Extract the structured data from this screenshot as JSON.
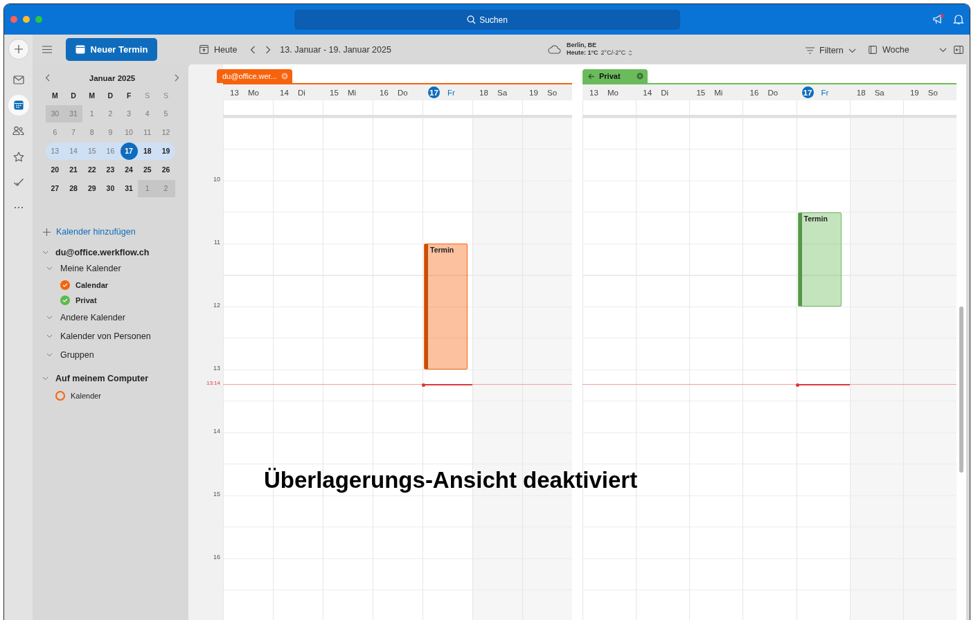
{
  "titlebar": {
    "search_placeholder": "Suchen"
  },
  "rail": [
    {
      "selected": false
    },
    {
      "selected": true
    },
    {
      "selected": false
    },
    {
      "selected": false
    },
    {
      "selected": false
    },
    {
      "selected": false
    }
  ],
  "toolbar": {
    "new_event": "Neuer Termin",
    "today": "Heute",
    "date_range": "13. Januar - 19. Januar 2025",
    "weather": {
      "city": "Berlin, BE",
      "today": "Heute: 1°C",
      "range": "2°C/-2°C"
    },
    "filter": "Filtern",
    "view": "Woche"
  },
  "mini_calendar": {
    "title": "Januar 2025",
    "weekdays": [
      {
        "label": "M",
        "weekend": false
      },
      {
        "label": "D",
        "weekend": false
      },
      {
        "label": "M",
        "weekend": false
      },
      {
        "label": "D",
        "weekend": false
      },
      {
        "label": "F",
        "weekend": false
      },
      {
        "label": "S",
        "weekend": true
      },
      {
        "label": "S",
        "weekend": true
      }
    ],
    "weeks": [
      {
        "highlighted": false,
        "days": [
          {
            "d": "30",
            "other_month": true,
            "past": true,
            "selected": false
          },
          {
            "d": "31",
            "other_month": true,
            "past": true,
            "selected": false
          },
          {
            "d": "1",
            "other_month": false,
            "past": true,
            "selected": false
          },
          {
            "d": "2",
            "other_month": false,
            "past": true,
            "selected": false
          },
          {
            "d": "3",
            "other_month": false,
            "past": true,
            "selected": false
          },
          {
            "d": "4",
            "other_month": false,
            "past": true,
            "selected": false
          },
          {
            "d": "5",
            "other_month": false,
            "past": true,
            "selected": false
          }
        ]
      },
      {
        "highlighted": false,
        "days": [
          {
            "d": "6",
            "other_month": false,
            "past": true,
            "selected": false
          },
          {
            "d": "7",
            "other_month": false,
            "past": true,
            "selected": false
          },
          {
            "d": "8",
            "other_month": false,
            "past": true,
            "selected": false
          },
          {
            "d": "9",
            "other_month": false,
            "past": true,
            "selected": false
          },
          {
            "d": "10",
            "other_month": false,
            "past": true,
            "selected": false
          },
          {
            "d": "11",
            "other_month": false,
            "past": true,
            "selected": false
          },
          {
            "d": "12",
            "other_month": false,
            "past": true,
            "selected": false
          }
        ]
      },
      {
        "highlighted": true,
        "days": [
          {
            "d": "13",
            "other_month": false,
            "past": true,
            "selected": false
          },
          {
            "d": "14",
            "other_month": false,
            "past": true,
            "selected": false
          },
          {
            "d": "15",
            "other_month": false,
            "past": true,
            "selected": false
          },
          {
            "d": "16",
            "other_month": false,
            "past": true,
            "selected": false
          },
          {
            "d": "17",
            "other_month": false,
            "past": false,
            "selected": true
          },
          {
            "d": "18",
            "other_month": false,
            "past": false,
            "selected": false
          },
          {
            "d": "19",
            "other_month": false,
            "past": false,
            "selected": false
          }
        ]
      },
      {
        "highlighted": false,
        "days": [
          {
            "d": "20",
            "other_month": false,
            "past": false,
            "selected": false
          },
          {
            "d": "21",
            "other_month": false,
            "past": false,
            "selected": false
          },
          {
            "d": "22",
            "other_month": false,
            "past": false,
            "selected": false
          },
          {
            "d": "23",
            "other_month": false,
            "past": false,
            "selected": false
          },
          {
            "d": "24",
            "other_month": false,
            "past": false,
            "selected": false
          },
          {
            "d": "25",
            "other_month": false,
            "past": false,
            "selected": false
          },
          {
            "d": "26",
            "other_month": false,
            "past": false,
            "selected": false
          }
        ]
      },
      {
        "highlighted": false,
        "days": [
          {
            "d": "27",
            "other_month": false,
            "past": false,
            "selected": false
          },
          {
            "d": "28",
            "other_month": false,
            "past": false,
            "selected": false
          },
          {
            "d": "29",
            "other_month": false,
            "past": false,
            "selected": false
          },
          {
            "d": "30",
            "other_month": false,
            "past": false,
            "selected": false
          },
          {
            "d": "31",
            "other_month": false,
            "past": false,
            "selected": false
          },
          {
            "d": "1",
            "other_month": true,
            "past": true,
            "selected": false
          },
          {
            "d": "2",
            "other_month": true,
            "past": true,
            "selected": false
          }
        ]
      }
    ]
  },
  "sidebar": {
    "add_calendar": "Kalender hinzufügen",
    "accounts": [
      {
        "label": "du@office.werkflow.ch",
        "expanded": true,
        "children": [
          {
            "kind": "group",
            "label": "Meine Kalender",
            "expanded": true,
            "children": [
              {
                "kind": "calendar",
                "label": "Calendar",
                "checked": true,
                "color": "#f7630c"
              },
              {
                "kind": "calendar",
                "label": "Privat",
                "checked": true,
                "color": "#5fb94e"
              }
            ]
          },
          {
            "kind": "group",
            "label": "Andere Kalender",
            "expanded": true
          },
          {
            "kind": "group",
            "label": "Kalender von Personen",
            "expanded": true
          },
          {
            "kind": "group",
            "label": "Gruppen",
            "expanded": true
          }
        ]
      },
      {
        "label": "Auf meinem Computer",
        "expanded": true,
        "children": [
          {
            "kind": "calendar",
            "label": "Kalender",
            "checked": false,
            "color": "#f7630c"
          }
        ]
      }
    ]
  },
  "time_axis": {
    "hours": [
      "10",
      "11",
      "12",
      "13",
      "14",
      "15",
      "16"
    ],
    "now": "13:14"
  },
  "calendars": [
    {
      "tab": "du@office.wer...",
      "color": "#f7630c",
      "back_arrow": false,
      "dark_text": false,
      "days": [
        {
          "num": "13",
          "name": "Mo",
          "today": false,
          "weekend": false
        },
        {
          "num": "14",
          "name": "Di",
          "today": false,
          "weekend": false
        },
        {
          "num": "15",
          "name": "Mi",
          "today": false,
          "weekend": false
        },
        {
          "num": "16",
          "name": "Do",
          "today": false,
          "weekend": false
        },
        {
          "num": "17",
          "name": "Fr",
          "today": true,
          "weekend": false
        },
        {
          "num": "18",
          "name": "Sa",
          "today": false,
          "weekend": true
        },
        {
          "num": "19",
          "name": "So",
          "today": false,
          "weekend": true
        }
      ],
      "events": [
        {
          "title": "Termin"
        }
      ]
    },
    {
      "tab": "Privat",
      "color": "#6bbb5c",
      "back_arrow": true,
      "dark_text": true,
      "days": [
        {
          "num": "13",
          "name": "Mo",
          "today": false,
          "weekend": false
        },
        {
          "num": "14",
          "name": "Di",
          "today": false,
          "weekend": false
        },
        {
          "num": "15",
          "name": "Mi",
          "today": false,
          "weekend": false
        },
        {
          "num": "16",
          "name": "Do",
          "today": false,
          "weekend": false
        },
        {
          "num": "17",
          "name": "Fr",
          "today": true,
          "weekend": false
        },
        {
          "num": "18",
          "name": "Sa",
          "today": false,
          "weekend": true
        },
        {
          "num": "19",
          "name": "So",
          "today": false,
          "weekend": true
        }
      ],
      "events": [
        {
          "title": "Termin"
        }
      ]
    }
  ],
  "overlay_caption": "Überlagerungs-Ansicht deaktiviert"
}
